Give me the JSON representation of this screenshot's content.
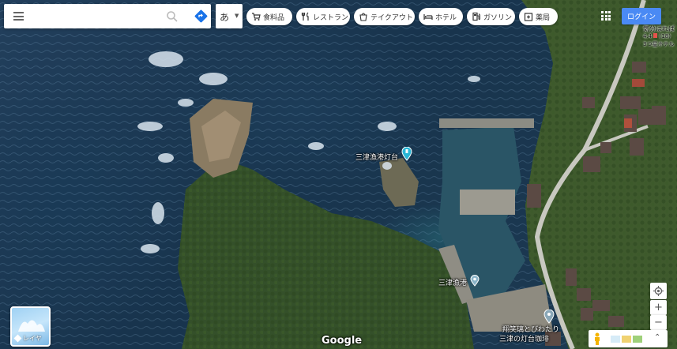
{
  "search": {
    "value": "",
    "placeholder": ""
  },
  "ime": {
    "label": "あ",
    "caret": "▼"
  },
  "chips": [
    {
      "label": "食料品",
      "icon": "cart-icon"
    },
    {
      "label": "レストラン",
      "icon": "fork-knife-icon"
    },
    {
      "label": "テイクアウト",
      "icon": "takeout-icon"
    },
    {
      "label": "ホテル",
      "icon": "bed-icon"
    },
    {
      "label": "ガソリン",
      "icon": "gas-pump-icon"
    },
    {
      "label": "薬局",
      "icon": "pharmacy-icon"
    }
  ],
  "login_label": "ログイン",
  "map": {
    "places": [
      {
        "name": "三津漁港灯台",
        "marker_color": "#29b6d6"
      },
      {
        "name": "三津漁港",
        "marker_color": "#8ab4c8"
      },
      {
        "name": "翔笑璃とびわたり",
        "line2": "三津の灯台珈琲"
      }
    ],
    "corner_label_1": "気分はれば",
    "corner_label_2": "4.4",
    "corner_label_3": "(18)",
    "corner_label_4": "3つ星ホテル"
  },
  "layer_label": "レイヤ",
  "google_logo": "Google",
  "zoom_in": "+",
  "zoom_out": "−"
}
